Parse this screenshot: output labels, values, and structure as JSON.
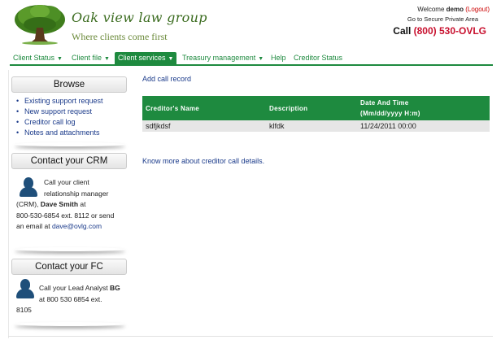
{
  "header": {
    "brand_name": "Oak view law group",
    "tagline": "Where clients come first",
    "welcome_prefix": "Welcome ",
    "username": "demo",
    "logout_label": "(Logout)",
    "secure_link": "Go to Secure Private Area",
    "call_prefix": "Call ",
    "phone": "(800) 530-OVLG"
  },
  "nav": {
    "items": [
      {
        "label": "Client Status",
        "has_caret": true,
        "active": false
      },
      {
        "label": "Client file",
        "has_caret": true,
        "active": false
      },
      {
        "label": "Client services",
        "has_caret": true,
        "active": true
      },
      {
        "label": "Treasury management",
        "has_caret": true,
        "active": false
      },
      {
        "label": "Help",
        "has_caret": false,
        "active": false
      },
      {
        "label": "Creditor Status",
        "has_caret": false,
        "active": false
      }
    ],
    "caret_glyph": "▼"
  },
  "sidebar": {
    "browse": {
      "title": "Browse",
      "links": [
        "Existing support request",
        "New support request",
        "Creditor call log",
        "Notes and attachments"
      ]
    },
    "crm": {
      "title": "Contact your CRM",
      "line1": "Call your client",
      "line2": "relationship manager",
      "line3_prefix": "(CRM), ",
      "manager_name": "Dave Smith",
      "line3_suffix": " at",
      "line4": "800-530-6854 ext. 8112 or send",
      "line5_prefix": "an email at ",
      "email": "dave@ovlg.com"
    },
    "fc": {
      "title": "Contact your FC",
      "line1_prefix": "Call your Lead Analyst ",
      "analyst": "BG",
      "line2": "at 800 530 6854 ext.",
      "line3": "8105"
    }
  },
  "main": {
    "add_call_label": "Add call record",
    "table": {
      "headers": [
        "Creditor's Name",
        "Description",
        "Date And Time",
        "(Mm/dd/yyyy H:m)"
      ],
      "rows": [
        {
          "creditor": "sdfjkdsf",
          "description": "klfdk",
          "datetime": "11/24/2011 00:00"
        }
      ]
    },
    "know_more_label": "Know more about creditor call details."
  },
  "colors": {
    "brand_green": "#1e8a3f",
    "phone_red": "#c8102e",
    "link_blue": "#1a3a8a",
    "icon_blue": "#1f4f7a"
  }
}
